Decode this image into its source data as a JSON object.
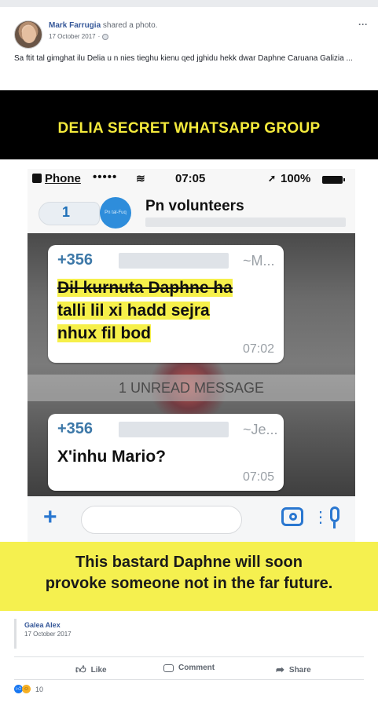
{
  "post": {
    "author": "Mark Farrugia",
    "action": "shared a photo.",
    "date": "17 October 2017",
    "more": "···",
    "text": "Sa ftit tal gimghat ilu Delia u n nies tieghu kienu qed jghidu hekk dwar Daphne Caruana Galizia ..."
  },
  "image": {
    "top_banner": "DELIA SECRET WHATSAPP GROUP",
    "status_bar": {
      "carrier": "Phone",
      "signal": "•••••",
      "time": "07:05",
      "battery": "100%"
    },
    "chat": {
      "back_count": "1",
      "avatar_label": "Pn tal-Fuq",
      "group_name": "Pn volunteers",
      "unread_label": "1 UNREAD MESSAGE",
      "messages": [
        {
          "sender_phone": "+356",
          "sender_alias": "~M...",
          "line1": "Dil kurnuta Daphne ha",
          "line2": "talli lil xi hadd sejra",
          "line3": "nhux fil bod",
          "time": "07:02"
        },
        {
          "sender_phone": "+356",
          "sender_alias": "~Je...",
          "line1": "X'inhu Mario?",
          "time": "07:05"
        }
      ]
    },
    "bottom_banner_line1": "This bastard Daphne will soon",
    "bottom_banner_line2": "provoke someone not in the far future."
  },
  "attribution": {
    "name": "Galea Alex",
    "date": "17 October 2017"
  },
  "actions": {
    "like": "Like",
    "comment": "Comment",
    "share": "Share"
  },
  "reactions": {
    "count": "10"
  },
  "colors": {
    "banner_yellow": "#f5f04f",
    "banner_text_yellow": "#f4ea3c",
    "link_blue": "#365899",
    "whatsapp_blue": "#2a77d0"
  }
}
